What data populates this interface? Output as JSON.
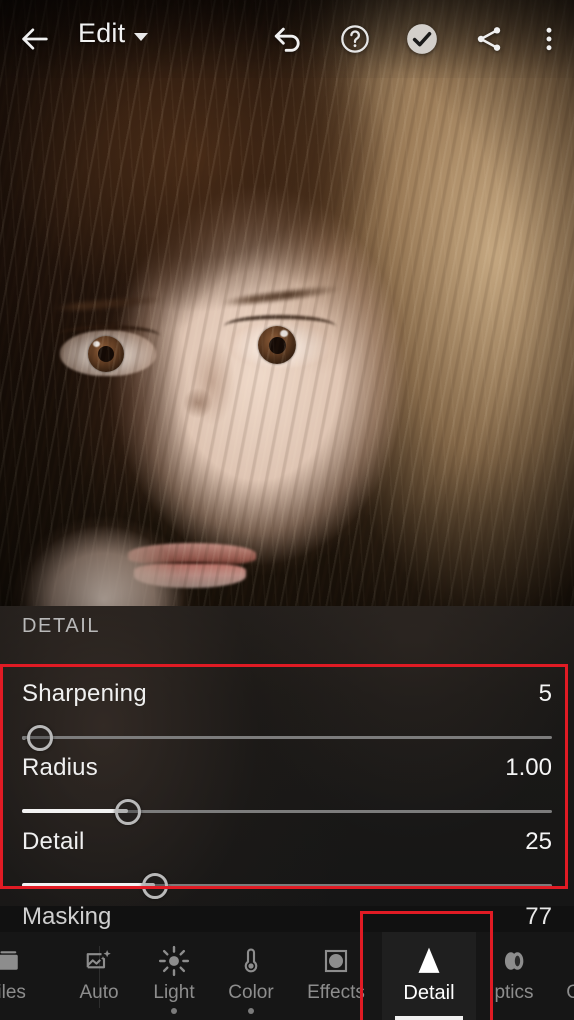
{
  "app": {
    "name": "Lightroom Mobile Editor",
    "accent_red": "#e01b24",
    "badge_blue": "#1473e6",
    "panel_bg": "#1d1d1d",
    "toolbar_bg": "#161616"
  },
  "topbar": {
    "back_icon": "arrow-left-icon",
    "title": "Edit",
    "title_caret": "chevron-down-icon",
    "actions": [
      {
        "name": "undo-icon",
        "label": "Undo"
      },
      {
        "name": "help-icon",
        "label": "Help"
      },
      {
        "name": "done-check-icon",
        "label": "Done"
      },
      {
        "name": "share-icon",
        "label": "Share"
      },
      {
        "name": "more-vert-icon",
        "label": "More options"
      }
    ]
  },
  "panel": {
    "section_title": "DETAIL",
    "sliders": [
      {
        "label": "Sharpening",
        "value": "5",
        "percent": 3.4,
        "has_origin_dot": true,
        "fill_from_left": false
      },
      {
        "label": "Radius",
        "value": "1.00",
        "percent": 20.0,
        "has_origin_dot": false,
        "fill_from_left": true
      },
      {
        "label": "Detail",
        "value": "25",
        "percent": 25.1,
        "has_origin_dot": false,
        "fill_from_left": true
      }
    ],
    "masking": {
      "label": "Masking",
      "value": "77"
    }
  },
  "toolbar": {
    "items": [
      {
        "label": "files",
        "icon": "profiles-icon",
        "active": false,
        "edited": false,
        "premium": false,
        "truncated": true
      },
      {
        "label": "Auto",
        "icon": "auto-icon",
        "active": false,
        "edited": false,
        "premium": false,
        "truncated": false
      },
      {
        "label": "Light",
        "icon": "light-icon",
        "active": false,
        "edited": true,
        "premium": false,
        "truncated": false
      },
      {
        "label": "Color",
        "icon": "color-icon",
        "active": false,
        "edited": true,
        "premium": false,
        "truncated": false
      },
      {
        "label": "Effects",
        "icon": "effects-icon",
        "active": false,
        "edited": false,
        "premium": false,
        "truncated": false
      },
      {
        "label": "Detail",
        "icon": "detail-icon",
        "active": true,
        "edited": false,
        "premium": false,
        "truncated": false
      },
      {
        "label": "ptics",
        "icon": "optics-icon",
        "active": false,
        "edited": false,
        "premium": false,
        "truncated": true
      },
      {
        "label": "Geomet",
        "icon": "geometry-icon",
        "active": false,
        "edited": false,
        "premium": true,
        "truncated": true
      }
    ]
  },
  "annotations": [
    {
      "name": "annotation-box-detail-sliders",
      "target": "sharpening-radius-detail-sliders",
      "color": "#e01b24"
    },
    {
      "name": "annotation-box-detail-tab",
      "target": "toolbar-detail-tab",
      "color": "#e01b24"
    }
  ]
}
